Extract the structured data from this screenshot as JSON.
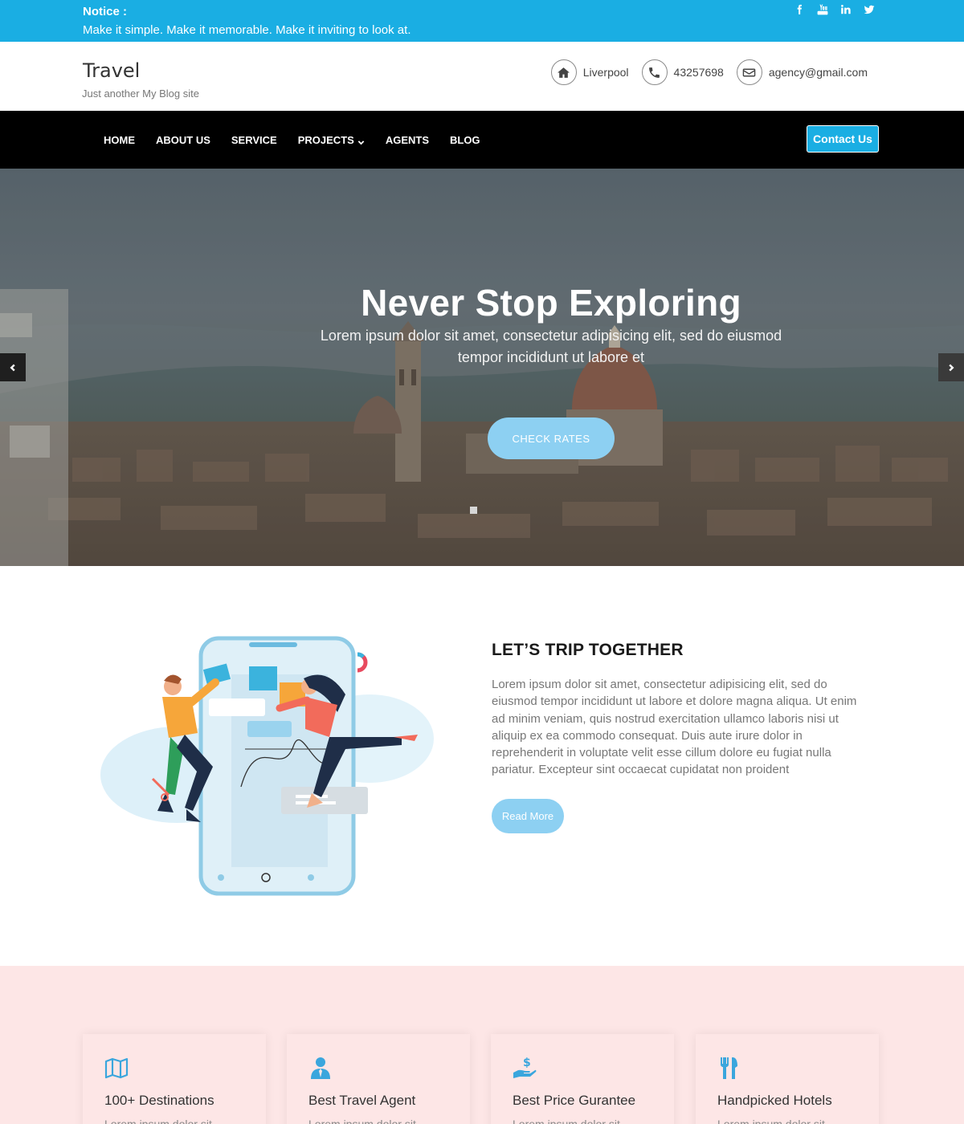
{
  "notice": {
    "title": "Notice :",
    "text": "Make it simple. Make it memorable. Make it inviting to look at.",
    "social": [
      "facebook-icon",
      "youtube-icon",
      "linkedin-icon",
      "twitter-icon"
    ]
  },
  "header": {
    "site_title": "Travel",
    "tagline": "Just another My Blog site",
    "location": "Liverpool",
    "phone": "43257698",
    "email": "agency@gmail.com"
  },
  "nav": {
    "items": [
      "HOME",
      "ABOUT US",
      "SERVICE",
      "PROJECTS",
      "AGENTS",
      "BLOG"
    ],
    "contact_label": "Contact Us"
  },
  "hero": {
    "title": "Never Stop Exploring",
    "subtitle": "Lorem ipsum dolor sit amet, consectetur adipisicing elit, sed do eiusmod tempor incididunt ut labore et",
    "button": "CHECK RATES"
  },
  "about": {
    "title": "LET’S TRIP TOGETHER",
    "text": "Lorem ipsum dolor sit amet, consectetur adipisicing elit, sed do eiusmod tempor incididunt ut labore et dolore magna aliqua. Ut enim ad minim veniam, quis nostrud exercitation ullamco laboris nisi ut aliquip ex ea commodo consequat. Duis aute irure dolor in reprehenderit in voluptate velit esse cillum dolore eu fugiat nulla pariatur. Excepteur sint occaecat cupidatat non proident",
    "button": "Read More"
  },
  "features": [
    {
      "icon": "map-icon",
      "title": "100+ Destinations",
      "text": "Lorem ipsum dolor sit"
    },
    {
      "icon": "agent-icon",
      "title": "Best Travel Agent",
      "text": "Lorem ipsum dolor sit"
    },
    {
      "icon": "price-icon",
      "title": "Best Price Gurantee",
      "text": "Lorem ipsum dolor sit"
    },
    {
      "icon": "cutlery-icon",
      "title": "Handpicked Hotels",
      "text": "Lorem ipsum dolor sit"
    }
  ],
  "colors": {
    "accent": "#1aaee3",
    "button_light": "#8dd0f2",
    "features_bg": "#fde6e6",
    "nav_bg": "#000000"
  }
}
